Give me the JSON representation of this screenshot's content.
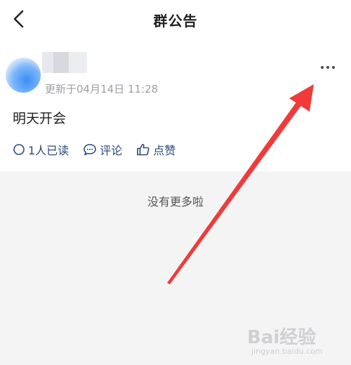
{
  "header": {
    "title": "群公告",
    "back_icon": "chevron-left-icon"
  },
  "announcement": {
    "updated_text": "更新于04月14日 11:28",
    "content": "明天开会",
    "more_icon": "more-horizontal-icon",
    "actions": {
      "read_label": "1人已读",
      "comment_label": "评论",
      "like_label": "点赞"
    }
  },
  "footer": {
    "no_more_text": "没有更多啦"
  },
  "annotation": {
    "arrow_color": "#f23a3a"
  },
  "watermark": {
    "brand": "Bai经验",
    "sub": "jingyan.baidu.com"
  },
  "colors": {
    "accent": "#2b4a7a",
    "muted": "#a0a0a5",
    "background": "#f4f4f5"
  }
}
